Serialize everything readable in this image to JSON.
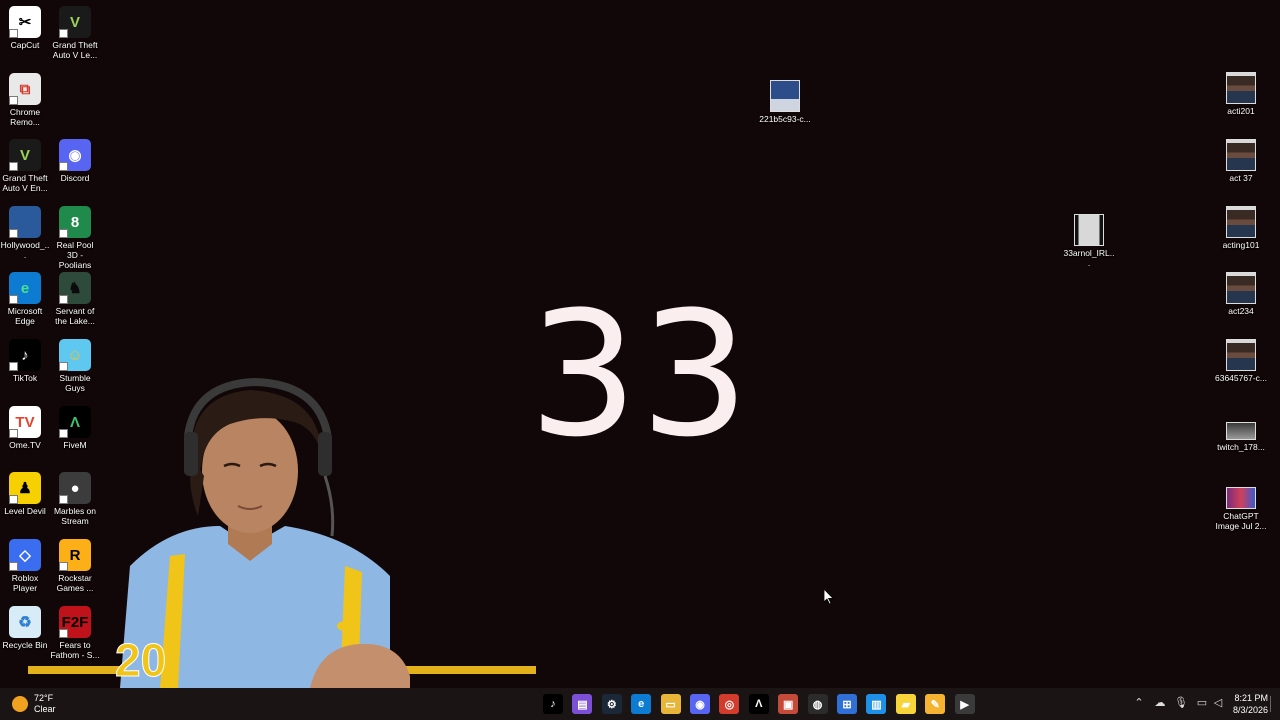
{
  "desktop": {
    "countdown_value": "33",
    "left_icons": [
      {
        "label": "CapCut",
        "icon": "capcut-icon",
        "color": "#ffffff",
        "glyph": "✂",
        "fg": "#000000"
      },
      {
        "label": "Grand Theft Auto V Le...",
        "icon": "gta-v-icon",
        "color": "#1a1a1a",
        "glyph": "V",
        "fg": "#9bd15a"
      },
      {
        "label": "Chrome Remo...",
        "icon": "chrome-remote-desktop-icon",
        "color": "#e9e9e9",
        "glyph": "⧉",
        "fg": "#d33b2c"
      },
      {
        "label": "Grand Theft Auto V En...",
        "icon": "gta-v-enhanced-icon",
        "color": "#1a1a1a",
        "glyph": "V",
        "fg": "#9bd15a"
      },
      {
        "label": "Discord",
        "icon": "discord-icon",
        "color": "#5865f2",
        "glyph": "◉",
        "fg": "#ffffff"
      },
      {
        "label": "Hollywood_...",
        "icon": "hollywood-file-icon",
        "color": "#2a5a9c",
        "glyph": "",
        "fg": "#ffffff"
      },
      {
        "label": "Real Pool 3D - Poolians",
        "icon": "real-pool-icon",
        "color": "#1f8a4c",
        "glyph": "8",
        "fg": "#ffffff"
      },
      {
        "label": "Microsoft Edge",
        "icon": "edge-icon",
        "color": "#0c7bd1",
        "glyph": "e",
        "fg": "#4be08d"
      },
      {
        "label": "Servant of the Lake...",
        "icon": "servant-of-the-lake-icon",
        "color": "#2d4a3a",
        "glyph": "♞",
        "fg": "#0b0b0b"
      },
      {
        "label": "TikTok",
        "icon": "tiktok-icon",
        "color": "#000000",
        "glyph": "♪",
        "fg": "#ffffff"
      },
      {
        "label": "Stumble Guys",
        "icon": "stumble-guys-icon",
        "color": "#5ec8f0",
        "glyph": "☺",
        "fg": "#f5c12b"
      },
      {
        "label": "Ome.TV",
        "icon": "ome-tv-icon",
        "color": "#ffffff",
        "glyph": "TV",
        "fg": "#e7432f"
      },
      {
        "label": "FiveM",
        "icon": "fivem-icon",
        "color": "#000000",
        "glyph": "Λ",
        "fg": "#43c06b"
      },
      {
        "label": "Level Devil",
        "icon": "level-devil-icon",
        "color": "#f6d000",
        "glyph": "♟",
        "fg": "#000000"
      },
      {
        "label": "Marbles on Stream",
        "icon": "marbles-on-stream-icon",
        "color": "#3c3c3c",
        "glyph": "●",
        "fg": "#ffffff"
      },
      {
        "label": "Roblox Player",
        "icon": "roblox-icon",
        "color": "#3b6df0",
        "glyph": "◇",
        "fg": "#ffffff"
      },
      {
        "label": "Rockstar Games ...",
        "icon": "rockstar-games-icon",
        "color": "#fcaf17",
        "glyph": "R",
        "fg": "#000000"
      },
      {
        "label": "Recycle Bin",
        "icon": "recycle-bin-icon",
        "color": "#d7ecf7",
        "glyph": "♻",
        "fg": "#2f7fcf"
      },
      {
        "label": "Fears to Fathom - S...",
        "icon": "fears-to-fathom-icon",
        "color": "#c0121b",
        "glyph": "F2F",
        "fg": "#000000"
      }
    ],
    "floating_files": [
      {
        "label": "221b5c93-c...",
        "icon": "image-file-icon"
      },
      {
        "label": "33arnol_IRL...",
        "icon": "video-file-icon"
      }
    ],
    "right_files": [
      {
        "label": "acti201",
        "icon": "image-file-icon"
      },
      {
        "label": "act 37",
        "icon": "image-file-icon"
      },
      {
        "label": "acting101",
        "icon": "image-file-icon"
      },
      {
        "label": "act234",
        "icon": "image-file-icon"
      },
      {
        "label": "63645767-c...",
        "icon": "image-file-icon"
      },
      {
        "label": "twitch_178...",
        "icon": "image-file-icon"
      },
      {
        "label": "ChatGPT Image Jul 2...",
        "icon": "image-file-icon"
      }
    ]
  },
  "taskbar": {
    "weather_temp": "72°F",
    "weather_desc": "Clear",
    "apps": [
      {
        "name": "tiktok",
        "icon": "tiktok-icon",
        "color": "#000000",
        "glyph": "♪"
      },
      {
        "name": "clapper",
        "icon": "clapperboard-icon",
        "color": "#7b4fd6",
        "glyph": "▤"
      },
      {
        "name": "steam",
        "icon": "steam-icon",
        "color": "#1b2838",
        "glyph": "⚙"
      },
      {
        "name": "edge",
        "icon": "edge-icon",
        "color": "#0c7bd1",
        "glyph": "e"
      },
      {
        "name": "file-explorer",
        "icon": "folder-icon",
        "color": "#e8b53a",
        "glyph": "▭"
      },
      {
        "name": "discord",
        "icon": "discord-icon",
        "color": "#5865f2",
        "glyph": "◉"
      },
      {
        "name": "chrome",
        "icon": "chrome-icon",
        "color": "#d33b2c",
        "glyph": "◎"
      },
      {
        "name": "fivem",
        "icon": "fivem-icon",
        "color": "#000000",
        "glyph": "Λ"
      },
      {
        "name": "video-editor",
        "icon": "video-editor-icon",
        "color": "#c44b3a",
        "glyph": "▣"
      },
      {
        "name": "obs",
        "icon": "obs-icon",
        "color": "#2b2b2b",
        "glyph": "◍"
      },
      {
        "name": "store",
        "icon": "microsoft-store-icon",
        "color": "#2f6fd6",
        "glyph": "⊞"
      },
      {
        "name": "notes",
        "icon": "notes-icon",
        "color": "#1e90e8",
        "glyph": "▥"
      },
      {
        "name": "sticky-notes",
        "icon": "sticky-notes-icon",
        "color": "#f7d43a",
        "glyph": "▰"
      },
      {
        "name": "sticky-notes-2",
        "icon": "sticky-notes-icon",
        "color": "#f5b331",
        "glyph": "✎"
      },
      {
        "name": "media-player",
        "icon": "media-player-icon",
        "color": "#3a3a3a",
        "glyph": "▶"
      }
    ],
    "clock_time": "8:21 PM",
    "clock_date": "8/3/2026"
  }
}
